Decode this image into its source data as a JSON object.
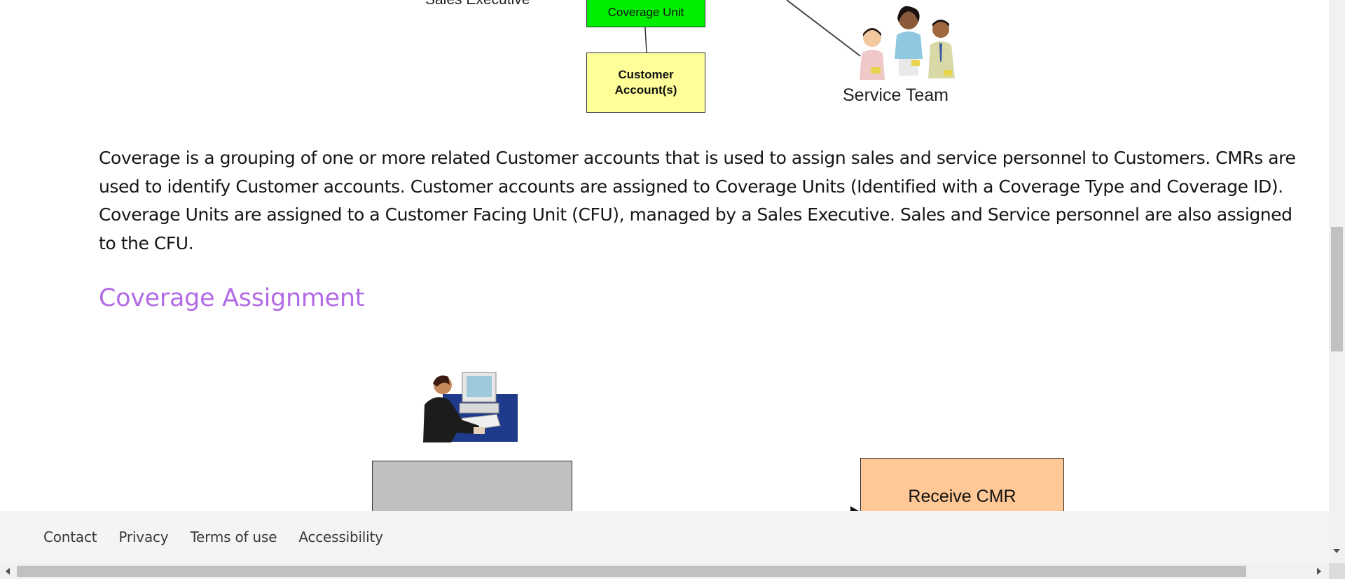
{
  "diagram_top": {
    "sales_executive_label": "Sales Executive",
    "coverage_unit_label": "Coverage Unit",
    "customer_accounts_label": "Customer Account(s)",
    "service_team_label": "Service Team",
    "coverage_unit_color": "#00ee00",
    "customer_accounts_color": "#ffff99"
  },
  "content": {
    "paragraph": "Coverage is a grouping of one or more related Customer accounts that is used to assign sales and service personnel to Customers. CMRs are used to identify Customer accounts. Customer accounts are assigned to Coverage Units (Identified with a Coverage Type and Coverage ID). Coverage Units are assigned to a Customer Facing Unit (CFU), managed by a Sales Executive. Sales and Service personnel are also assigned to the CFU.",
    "section_heading": "Coverage Assignment",
    "heading_color": "#b36be6"
  },
  "diagram_bottom": {
    "receive_cmr_label": "Receive CMR",
    "grey_box_color": "#c0c0c0",
    "orange_box_color": "#ffc896"
  },
  "footer": {
    "links": [
      "Contact",
      "Privacy",
      "Terms of use",
      "Accessibility"
    ]
  }
}
